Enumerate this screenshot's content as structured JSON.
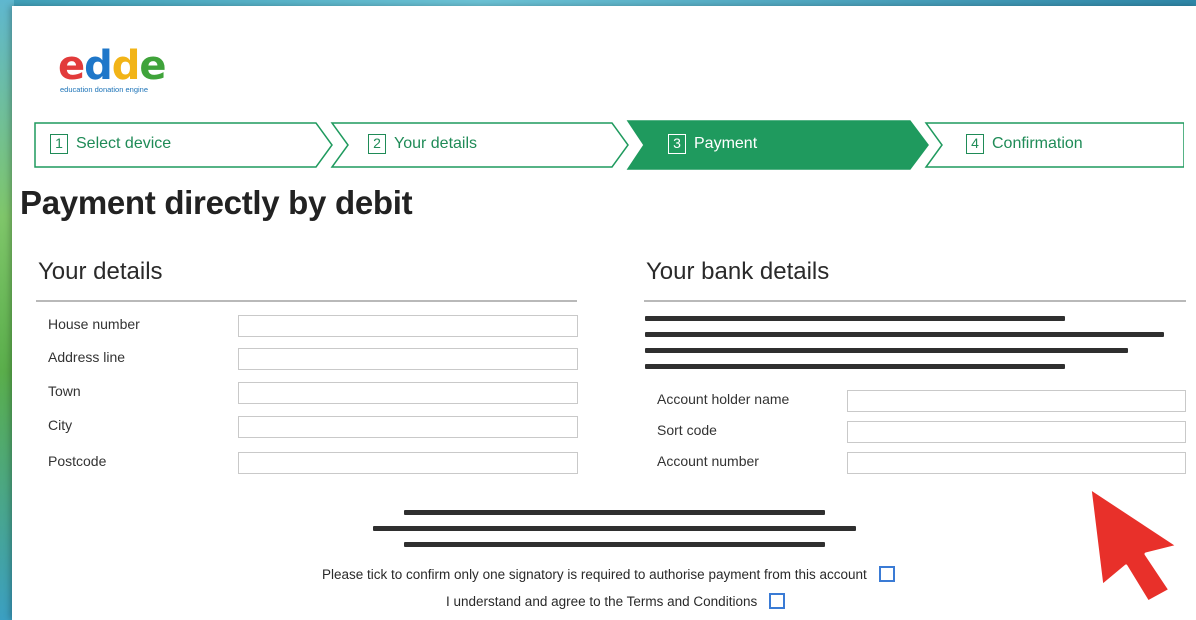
{
  "logo": {
    "letters": [
      "e",
      "d",
      "d",
      "e"
    ],
    "letter_colors": [
      "#e23b3b",
      "#1f77c9",
      "#f2b417",
      "#3fa33a"
    ],
    "tagline": "education donation engine"
  },
  "steps": [
    {
      "num": "1",
      "label": "Select device",
      "active": false
    },
    {
      "num": "2",
      "label": "Your details",
      "active": false
    },
    {
      "num": "3",
      "label": "Payment",
      "active": true
    },
    {
      "num": "4",
      "label": "Confirmation",
      "active": false
    }
  ],
  "page_title": "Payment directly by debit",
  "your_details": {
    "title": "Your details",
    "fields": [
      {
        "label": "House number",
        "value": ""
      },
      {
        "label": "Address line",
        "value": ""
      },
      {
        "label": "Town",
        "value": ""
      },
      {
        "label": "City",
        "value": ""
      },
      {
        "label": "Postcode",
        "value": ""
      }
    ]
  },
  "bank_details": {
    "title": "Your bank details",
    "fields": [
      {
        "label": "Account holder name",
        "value": ""
      },
      {
        "label": "Sort code",
        "value": ""
      },
      {
        "label": "Account number",
        "value": ""
      }
    ]
  },
  "confirmations": {
    "signatory": "Please tick to confirm only one signatory is required to authorise payment from this account",
    "terms": "I understand and agree to the Terms and Conditions"
  },
  "colors": {
    "accent_green": "#1f9a5e",
    "checkbox_blue": "#3a7bd5",
    "cursor_red": "#e8302a"
  }
}
